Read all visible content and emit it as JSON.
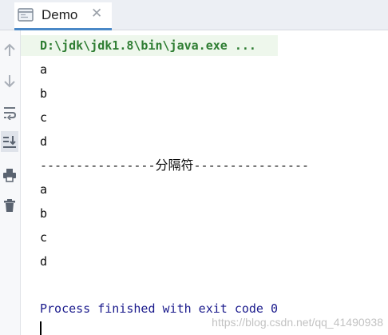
{
  "tab": {
    "title": "Demo",
    "close_glyph": "✕",
    "icon": "console-window-icon"
  },
  "toolbar": {
    "items": [
      {
        "icon": "arrow-up-icon"
      },
      {
        "icon": "arrow-down-icon"
      },
      {
        "icon": "soft-wrap-icon"
      },
      {
        "icon": "scroll-to-end-icon",
        "active": true
      },
      {
        "icon": "print-icon"
      },
      {
        "icon": "trash-icon"
      }
    ]
  },
  "console": {
    "command": "D:\\jdk\\jdk1.8\\bin\\java.exe ...",
    "output_first": [
      "a",
      "b",
      "c",
      "d"
    ],
    "separator": {
      "left": "----------------",
      "label": "分隔符",
      "right": "----------------"
    },
    "output_second": [
      "a",
      "b",
      "c",
      "d"
    ],
    "finish": "Process finished with exit code 0"
  },
  "watermark": "https://blog.csdn.net/qq_41490938",
  "colors": {
    "command": "#2e7d32",
    "finish": "#1a1a8c",
    "accent": "#4a88c7"
  }
}
